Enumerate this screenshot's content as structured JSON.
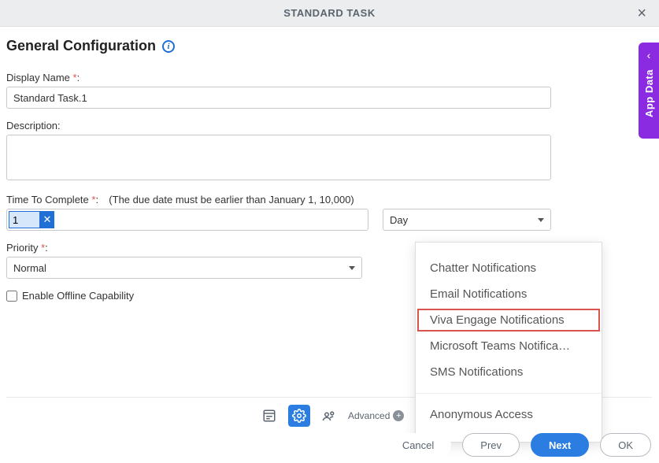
{
  "titlebar": {
    "title": "STANDARD TASK"
  },
  "section": {
    "title": "General Configuration"
  },
  "fields": {
    "displayName": {
      "label": "Display Name",
      "value": "Standard Task.1"
    },
    "description": {
      "label": "Description:",
      "value": ""
    },
    "timeToComplete": {
      "label": "Time To Complete",
      "hint": "(The due date must be earlier than January 1, 10,000)",
      "value": "1",
      "unit": "Day"
    },
    "priority": {
      "label": "Priority",
      "value": "Normal"
    },
    "enableOffline": {
      "label": "Enable Offline Capability",
      "checked": false
    }
  },
  "toolbar": {
    "advanced": "Advanced"
  },
  "menu": {
    "items": [
      "Chatter Notifications",
      "Email Notifications",
      "Viva Engage Notifications",
      "Microsoft Teams Notifica…",
      "SMS Notifications"
    ],
    "footer": "Anonymous Access",
    "highlightIndex": 2
  },
  "footer": {
    "cancel": "Cancel",
    "prev": "Prev",
    "next": "Next",
    "ok": "OK"
  },
  "sideTab": {
    "label": "App Data"
  }
}
